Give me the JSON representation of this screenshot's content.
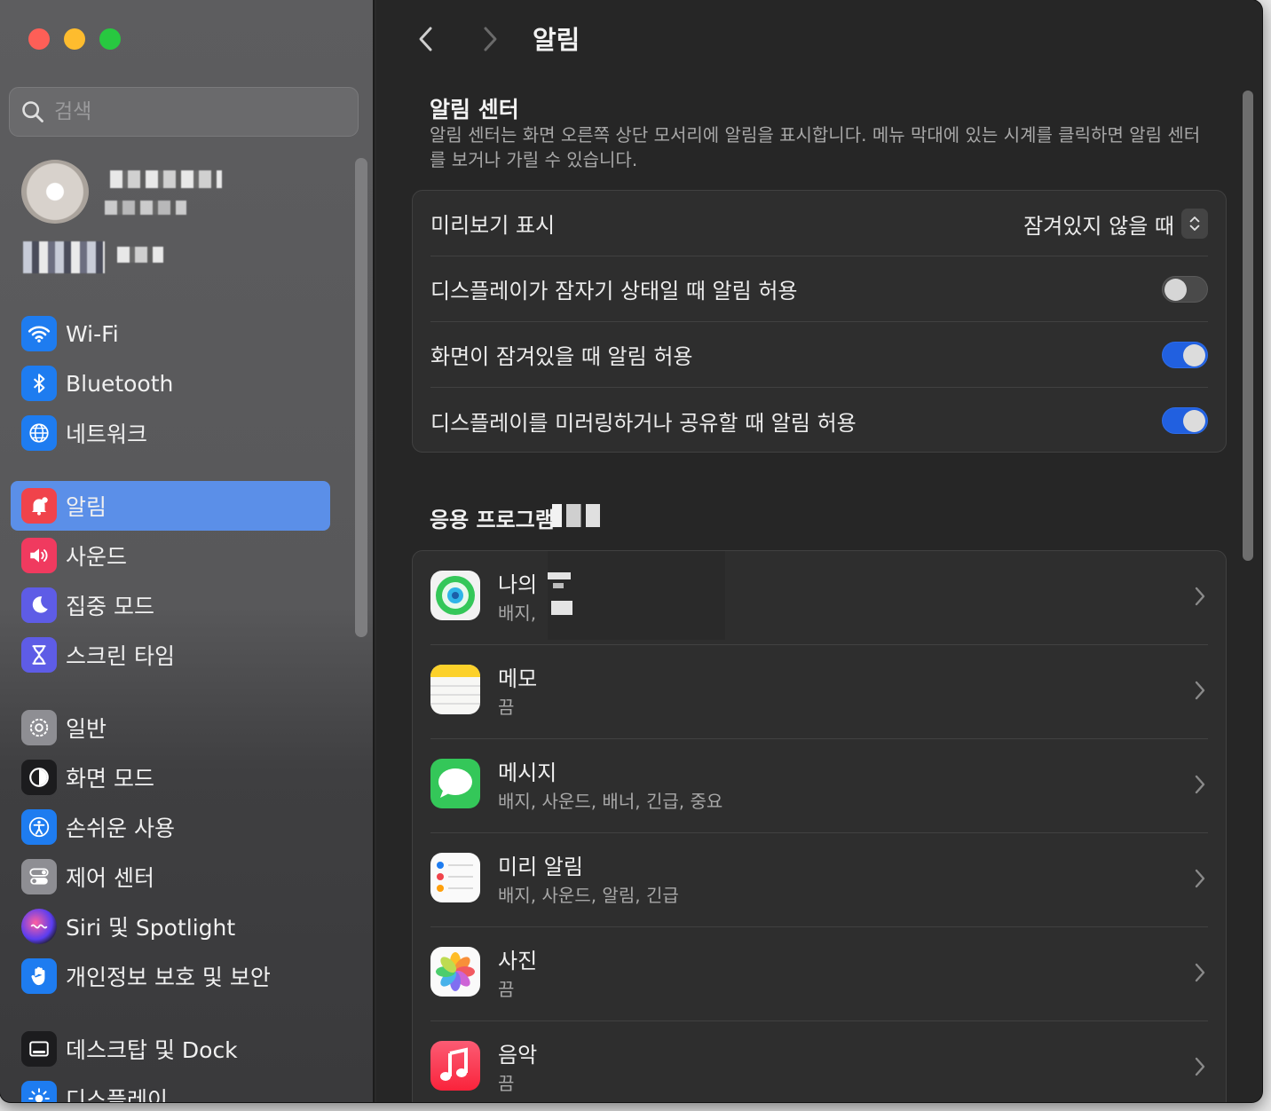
{
  "window": {
    "title": "알림"
  },
  "sidebar": {
    "search": {
      "placeholder": "검색",
      "value": ""
    },
    "items": [
      {
        "id": "wifi",
        "label": "Wi-Fi",
        "icon": "wifi-icon",
        "color": "#1e7cf0",
        "selected": false
      },
      {
        "id": "bluetooth",
        "label": "Bluetooth",
        "icon": "bluetooth-icon",
        "color": "#1e7cf0",
        "selected": false
      },
      {
        "id": "network",
        "label": "네트워크",
        "icon": "globe-icon",
        "color": "#1e7cf0",
        "selected": false
      },
      {
        "id": "notifications",
        "label": "알림",
        "icon": "bell-icon",
        "color": "#f0434b",
        "selected": true
      },
      {
        "id": "sound",
        "label": "사운드",
        "icon": "speaker-icon",
        "color": "#f03a5f",
        "selected": false
      },
      {
        "id": "focus",
        "label": "집중 모드",
        "icon": "moon-icon",
        "color": "#5e5ce6",
        "selected": false
      },
      {
        "id": "screentime",
        "label": "스크린 타임",
        "icon": "hourglass-icon",
        "color": "#5e5ce6",
        "selected": false
      },
      {
        "id": "general",
        "label": "일반",
        "icon": "gear-icon",
        "color": "#8e8e93",
        "selected": false
      },
      {
        "id": "appearance",
        "label": "화면 모드",
        "icon": "appearance-icon",
        "color": "#1c1c1e",
        "selected": false
      },
      {
        "id": "accessibility",
        "label": "손쉬운 사용",
        "icon": "accessibility-icon",
        "color": "#1e7cf0",
        "selected": false
      },
      {
        "id": "controlcenter",
        "label": "제어 센터",
        "icon": "switches-icon",
        "color": "#8e8e93",
        "selected": false
      },
      {
        "id": "siri",
        "label": "Siri 및 Spotlight",
        "icon": "siri-icon",
        "color": "#2b2b2b",
        "selected": false
      },
      {
        "id": "privacy",
        "label": "개인정보 보호 및 보안",
        "icon": "hand-icon",
        "color": "#1e7cf0",
        "selected": false
      },
      {
        "id": "desktop",
        "label": "데스크탑 및 Dock",
        "icon": "dock-icon",
        "color": "#1c1c1e",
        "selected": false
      },
      {
        "id": "displays",
        "label": "디스플레이",
        "icon": "sun-icon",
        "color": "#1e7cf0",
        "selected": false
      }
    ]
  },
  "main": {
    "title": "알림",
    "section": {
      "title": "알림 센터",
      "description": "알림 센터는 화면 오른쪽 상단 모서리에 알림을 표시합니다. 메뉴 막대에 있는 시계를 클릭하면 알림 센터를 보거나 가릴 수 있습니다."
    },
    "settings": [
      {
        "id": "preview",
        "label": "미리보기 표시",
        "type": "popup",
        "value": "잠겨있지 않을 때"
      },
      {
        "id": "sleep",
        "label": "디스플레이가 잠자기 상태일 때 알림 허용",
        "type": "toggle",
        "on": false
      },
      {
        "id": "locked",
        "label": "화면이 잠겨있을 때 알림 허용",
        "type": "toggle",
        "on": true
      },
      {
        "id": "mirroring",
        "label": "디스플레이를 미러링하거나 공유할 때 알림 허용",
        "type": "toggle",
        "on": true
      }
    ],
    "apps_title": "응용 프로그램",
    "apps": [
      {
        "id": "findmy",
        "name": "나의",
        "sub": "배지,",
        "icon": "findmy-icon"
      },
      {
        "id": "notes",
        "name": "메모",
        "sub": "끔",
        "icon": "notes-icon"
      },
      {
        "id": "messages",
        "name": "메시지",
        "sub": "배지, 사운드, 배너, 긴급, 중요",
        "icon": "messages-icon"
      },
      {
        "id": "reminders",
        "name": "미리 알림",
        "sub": "배지, 사운드, 알림, 긴급",
        "icon": "reminders-icon"
      },
      {
        "id": "photos",
        "name": "사진",
        "sub": "끔",
        "icon": "photos-icon"
      },
      {
        "id": "music",
        "name": "음악",
        "sub": "끔",
        "icon": "music-icon"
      }
    ]
  },
  "colors": {
    "accent": "#2160e0",
    "selection": "#5b8fe8"
  }
}
